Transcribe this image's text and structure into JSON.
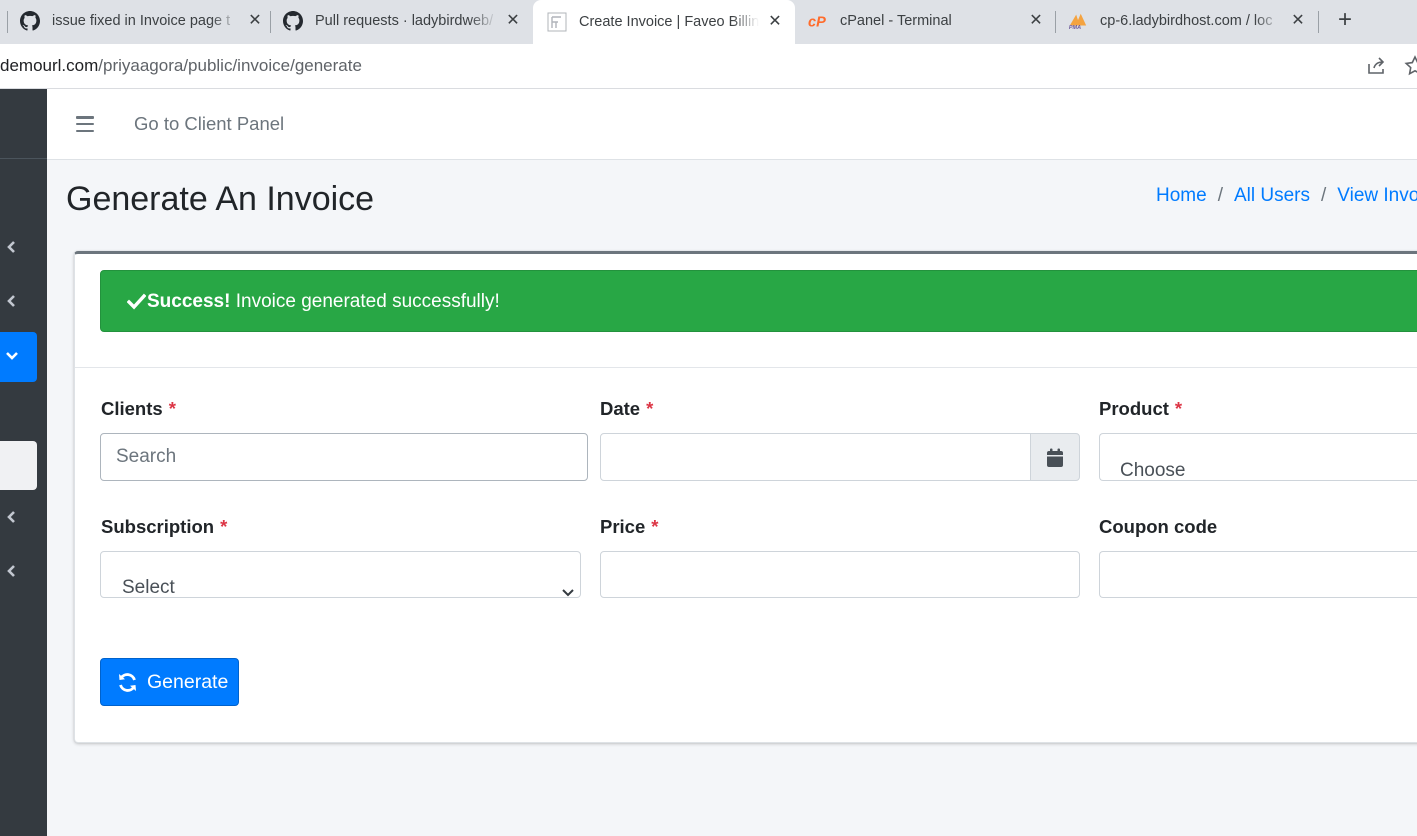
{
  "browser": {
    "tabs": [
      {
        "title": "issue fixed in Invoice page t",
        "icon": "github-icon"
      },
      {
        "title": "Pull requests · ladybirdweb/",
        "icon": "github-icon"
      },
      {
        "title": "Create Invoice | Faveo Billing",
        "icon": "faveo-icon",
        "active": true
      },
      {
        "title": "cPanel - Terminal",
        "icon": "cpanel-icon"
      },
      {
        "title": "cp-6.ladybirdhost.com / loc",
        "icon": "phpmyadmin-icon"
      }
    ],
    "close_glyph": "✕",
    "new_tab_glyph": "+",
    "url_host": "demourl.com",
    "url_path": "/priyaagora/public/invoice/generate"
  },
  "navbar": {
    "client_panel_link": "Go to Client Panel"
  },
  "header": {
    "title": "Generate An Invoice",
    "breadcrumb": [
      "Home",
      "All Users",
      "View Invoi"
    ],
    "breadcrumb_sep": "/"
  },
  "alert": {
    "strong": "Success!",
    "message": " Invoice generated successfully!",
    "color": "#28a745"
  },
  "form": {
    "clients": {
      "label": "Clients",
      "required_mark": "*",
      "placeholder": "Search"
    },
    "date": {
      "label": "Date",
      "required_mark": "*",
      "value": ""
    },
    "product": {
      "label": "Product",
      "required_mark": "*",
      "selected": "Choose"
    },
    "subscription": {
      "label": "Subscription",
      "required_mark": "*",
      "selected": "Select"
    },
    "price": {
      "label": "Price",
      "required_mark": "*",
      "value": ""
    },
    "coupon": {
      "label": "Coupon code",
      "value": ""
    },
    "generate_button": "Generate"
  },
  "colors": {
    "primary": "#007bff",
    "sidebar": "#343a40",
    "required": "#dc3545"
  }
}
